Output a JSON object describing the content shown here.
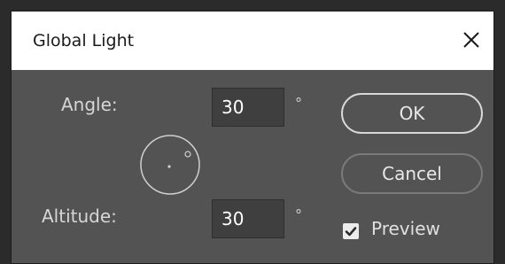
{
  "dialog": {
    "title": "Global Light"
  },
  "angle": {
    "label": "Angle:",
    "value": "30",
    "unit": "°"
  },
  "altitude": {
    "label": "Altitude:",
    "value": "30",
    "unit": "°"
  },
  "buttons": {
    "ok_label": "OK",
    "cancel_label": "Cancel"
  },
  "preview": {
    "label": "Preview",
    "checked": true
  },
  "icons": {
    "close": "close-icon",
    "dial": "angle-dial-icon",
    "check": "checkmark-icon"
  },
  "colors": {
    "dialog_bg": "#535353",
    "titlebar_bg": "#ffffff",
    "input_bg": "#3f3f3f"
  }
}
